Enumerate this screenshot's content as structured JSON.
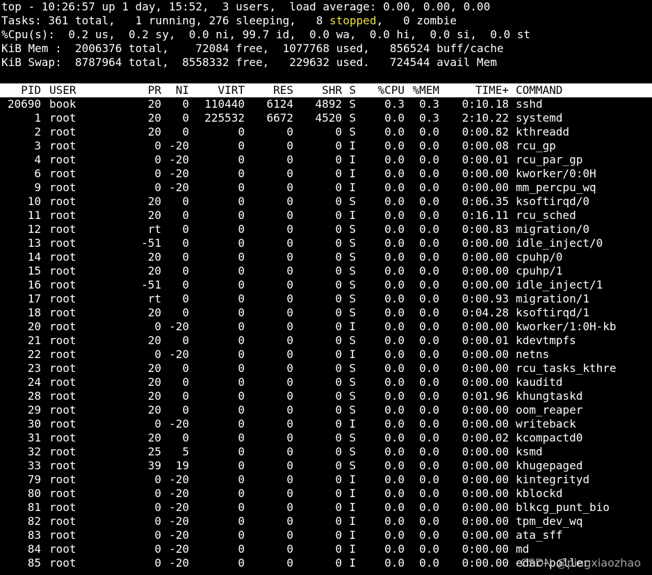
{
  "summary": {
    "line1": "top - 10:26:57 up 1 day, 15:52,  3 users,  load average: 0.00, 0.00, 0.00",
    "line2_pre": "Tasks: 361 total,   1 running, 276 sleeping,   8 ",
    "line2_stopped": "stopped",
    "line2_post": ",   0 zombie",
    "line3": "%Cpu(s):  0.2 us,  0.2 sy,  0.0 ni, 99.7 id,  0.0 wa,  0.0 hi,  0.0 si,  0.0 st",
    "line4": "KiB Mem :  2006376 total,    72084 free,  1077768 used,   856524 buff/cache",
    "line5": "KiB Swap:  8787964 total,  8558332 free,   229632 used.   724544 avail Mem"
  },
  "colors": {
    "background": "#000000",
    "text": "#ffffff",
    "highlight": "#f0e040",
    "header_bg": "#ffffff",
    "header_text": "#000000"
  },
  "columns": [
    "PID",
    "USER",
    "PR",
    "NI",
    "VIRT",
    "RES",
    "SHR",
    "S",
    "%CPU",
    "%MEM",
    "TIME+",
    "COMMAND"
  ],
  "processes": [
    [
      "20690",
      "book",
      "20",
      "0",
      "110440",
      "6124",
      "4892",
      "S",
      "0.3",
      "0.3",
      "0:10.18",
      "sshd"
    ],
    [
      "1",
      "root",
      "20",
      "0",
      "225532",
      "6672",
      "4520",
      "S",
      "0.0",
      "0.3",
      "2:10.22",
      "systemd"
    ],
    [
      "2",
      "root",
      "20",
      "0",
      "0",
      "0",
      "0",
      "S",
      "0.0",
      "0.0",
      "0:00.82",
      "kthreadd"
    ],
    [
      "3",
      "root",
      "0",
      "-20",
      "0",
      "0",
      "0",
      "I",
      "0.0",
      "0.0",
      "0:00.08",
      "rcu_gp"
    ],
    [
      "4",
      "root",
      "0",
      "-20",
      "0",
      "0",
      "0",
      "I",
      "0.0",
      "0.0",
      "0:00.01",
      "rcu_par_gp"
    ],
    [
      "6",
      "root",
      "0",
      "-20",
      "0",
      "0",
      "0",
      "I",
      "0.0",
      "0.0",
      "0:00.00",
      "kworker/0:0H"
    ],
    [
      "9",
      "root",
      "0",
      "-20",
      "0",
      "0",
      "0",
      "I",
      "0.0",
      "0.0",
      "0:00.00",
      "mm_percpu_wq"
    ],
    [
      "10",
      "root",
      "20",
      "0",
      "0",
      "0",
      "0",
      "S",
      "0.0",
      "0.0",
      "0:06.35",
      "ksoftirqd/0"
    ],
    [
      "11",
      "root",
      "20",
      "0",
      "0",
      "0",
      "0",
      "I",
      "0.0",
      "0.0",
      "0:16.11",
      "rcu_sched"
    ],
    [
      "12",
      "root",
      "rt",
      "0",
      "0",
      "0",
      "0",
      "S",
      "0.0",
      "0.0",
      "0:00.83",
      "migration/0"
    ],
    [
      "13",
      "root",
      "-51",
      "0",
      "0",
      "0",
      "0",
      "S",
      "0.0",
      "0.0",
      "0:00.00",
      "idle_inject/0"
    ],
    [
      "14",
      "root",
      "20",
      "0",
      "0",
      "0",
      "0",
      "S",
      "0.0",
      "0.0",
      "0:00.00",
      "cpuhp/0"
    ],
    [
      "15",
      "root",
      "20",
      "0",
      "0",
      "0",
      "0",
      "S",
      "0.0",
      "0.0",
      "0:00.00",
      "cpuhp/1"
    ],
    [
      "16",
      "root",
      "-51",
      "0",
      "0",
      "0",
      "0",
      "S",
      "0.0",
      "0.0",
      "0:00.00",
      "idle_inject/1"
    ],
    [
      "17",
      "root",
      "rt",
      "0",
      "0",
      "0",
      "0",
      "S",
      "0.0",
      "0.0",
      "0:00.93",
      "migration/1"
    ],
    [
      "18",
      "root",
      "20",
      "0",
      "0",
      "0",
      "0",
      "S",
      "0.0",
      "0.0",
      "0:04.28",
      "ksoftirqd/1"
    ],
    [
      "20",
      "root",
      "0",
      "-20",
      "0",
      "0",
      "0",
      "I",
      "0.0",
      "0.0",
      "0:00.00",
      "kworker/1:0H-kb"
    ],
    [
      "21",
      "root",
      "20",
      "0",
      "0",
      "0",
      "0",
      "S",
      "0.0",
      "0.0",
      "0:00.01",
      "kdevtmpfs"
    ],
    [
      "22",
      "root",
      "0",
      "-20",
      "0",
      "0",
      "0",
      "I",
      "0.0",
      "0.0",
      "0:00.00",
      "netns"
    ],
    [
      "23",
      "root",
      "20",
      "0",
      "0",
      "0",
      "0",
      "S",
      "0.0",
      "0.0",
      "0:00.00",
      "rcu_tasks_kthre"
    ],
    [
      "24",
      "root",
      "20",
      "0",
      "0",
      "0",
      "0",
      "S",
      "0.0",
      "0.0",
      "0:00.00",
      "kauditd"
    ],
    [
      "28",
      "root",
      "20",
      "0",
      "0",
      "0",
      "0",
      "S",
      "0.0",
      "0.0",
      "0:01.96",
      "khungtaskd"
    ],
    [
      "29",
      "root",
      "20",
      "0",
      "0",
      "0",
      "0",
      "S",
      "0.0",
      "0.0",
      "0:00.00",
      "oom_reaper"
    ],
    [
      "30",
      "root",
      "0",
      "-20",
      "0",
      "0",
      "0",
      "I",
      "0.0",
      "0.0",
      "0:00.00",
      "writeback"
    ],
    [
      "31",
      "root",
      "20",
      "0",
      "0",
      "0",
      "0",
      "S",
      "0.0",
      "0.0",
      "0:00.02",
      "kcompactd0"
    ],
    [
      "32",
      "root",
      "25",
      "5",
      "0",
      "0",
      "0",
      "S",
      "0.0",
      "0.0",
      "0:00.00",
      "ksmd"
    ],
    [
      "33",
      "root",
      "39",
      "19",
      "0",
      "0",
      "0",
      "S",
      "0.0",
      "0.0",
      "0:00.00",
      "khugepaged"
    ],
    [
      "79",
      "root",
      "0",
      "-20",
      "0",
      "0",
      "0",
      "I",
      "0.0",
      "0.0",
      "0:00.00",
      "kintegrityd"
    ],
    [
      "80",
      "root",
      "0",
      "-20",
      "0",
      "0",
      "0",
      "I",
      "0.0",
      "0.0",
      "0:00.00",
      "kblockd"
    ],
    [
      "81",
      "root",
      "0",
      "-20",
      "0",
      "0",
      "0",
      "I",
      "0.0",
      "0.0",
      "0:00.00",
      "blkcg_punt_bio"
    ],
    [
      "82",
      "root",
      "0",
      "-20",
      "0",
      "0",
      "0",
      "I",
      "0.0",
      "0.0",
      "0:00.00",
      "tpm_dev_wq"
    ],
    [
      "83",
      "root",
      "0",
      "-20",
      "0",
      "0",
      "0",
      "I",
      "0.0",
      "0.0",
      "0:00.00",
      "ata_sff"
    ],
    [
      "84",
      "root",
      "0",
      "-20",
      "0",
      "0",
      "0",
      "I",
      "0.0",
      "0.0",
      "0:00.00",
      "md"
    ],
    [
      "85",
      "root",
      "0",
      "-20",
      "0",
      "0",
      "0",
      "I",
      "0.0",
      "0.0",
      "0:00.00",
      "edac-poller"
    ]
  ],
  "watermark": "CSDN @pingxiaozhao"
}
